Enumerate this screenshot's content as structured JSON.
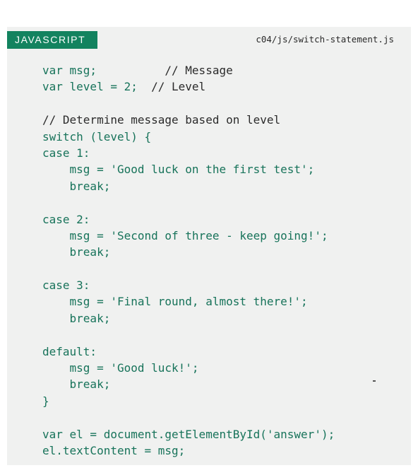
{
  "header": {
    "language_label": "JAVASCRIPT",
    "file_path": "c04/js/switch-statement.js"
  },
  "code": {
    "lines": [
      [
        {
          "t": "var msg;          ",
          "c": "code"
        },
        {
          "t": "// Message",
          "c": "comment"
        }
      ],
      [
        {
          "t": "var level = 2;  ",
          "c": "code"
        },
        {
          "t": "// Level",
          "c": "comment"
        }
      ],
      [],
      [
        {
          "t": "// Determine message based on level",
          "c": "comment"
        }
      ],
      [
        {
          "t": "switch (level) {",
          "c": "code"
        }
      ],
      [
        {
          "t": "case 1:",
          "c": "code"
        }
      ],
      [
        {
          "t": "    msg = 'Good luck on the first test';",
          "c": "code"
        }
      ],
      [
        {
          "t": "    break;",
          "c": "code"
        }
      ],
      [],
      [
        {
          "t": "case 2:",
          "c": "code"
        }
      ],
      [
        {
          "t": "    msg = 'Second of three - keep going!';",
          "c": "code"
        }
      ],
      [
        {
          "t": "    break;",
          "c": "code"
        }
      ],
      [],
      [
        {
          "t": "case 3:",
          "c": "code"
        }
      ],
      [
        {
          "t": "    msg = 'Final round, almost there!';",
          "c": "code"
        }
      ],
      [
        {
          "t": "    break;",
          "c": "code"
        }
      ],
      [],
      [
        {
          "t": "default:",
          "c": "code"
        }
      ],
      [
        {
          "t": "    msg = 'Good luck!';",
          "c": "code"
        }
      ],
      [
        {
          "t": "    break;",
          "c": "code"
        }
      ],
      [
        {
          "t": "}",
          "c": "code"
        }
      ],
      [],
      [
        {
          "t": "var el = document.getElementById('answer');",
          "c": "code"
        }
      ],
      [
        {
          "t": "el.textContent = msg;",
          "c": "code"
        }
      ]
    ]
  },
  "colors": {
    "tab_background": "#13835f",
    "code_text": "#17735a",
    "comment_text": "#2b2b2b",
    "panel_background": "#f0f1f0"
  }
}
